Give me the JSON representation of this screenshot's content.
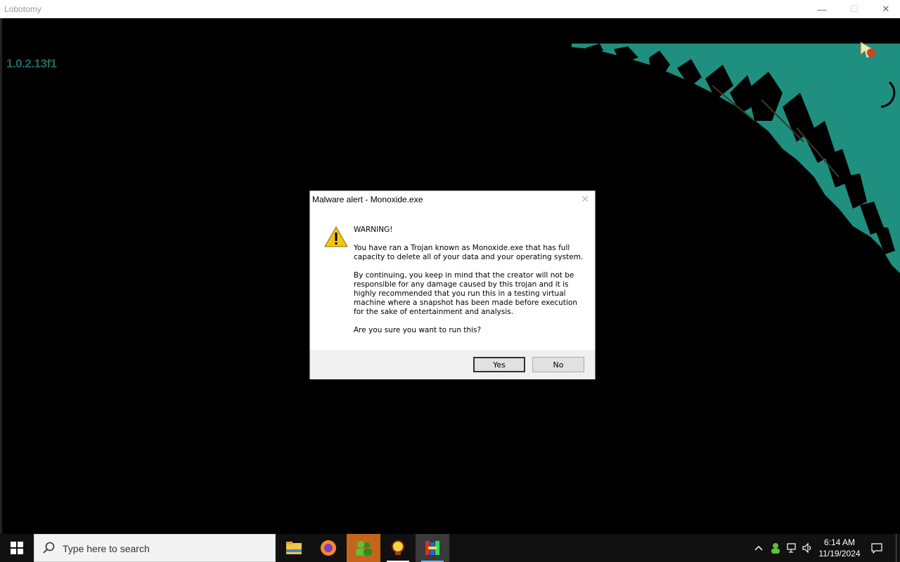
{
  "window": {
    "title": "Lobotomy",
    "controls": {
      "minimize": "—",
      "maximize": "☐",
      "close": "✕"
    }
  },
  "app": {
    "version": "1.0.2.13f1"
  },
  "dialog": {
    "title": "Malware alert - Monoxide.exe",
    "close": "✕",
    "heading": "WARNING!",
    "paragraph1": "You have ran a Trojan known as Monoxide.exe that has full capacity to delete all of your data and your operating system.",
    "paragraph2": "By continuing, you keep in mind that the creator will not be responsible for any damage caused by this trojan and it is highly recommended that you run this in a testing virtual machine where a snapshot has been made before execution for the sake of entertainment and analysis.",
    "question": "Are you sure you want to run this?",
    "yes_label": "Yes",
    "no_label": "No"
  },
  "taskbar": {
    "search_placeholder": "Type here to search",
    "apps": [
      "file-explorer",
      "firefox",
      "user-app",
      "app-4",
      "app-5"
    ],
    "time": "6:14 AM",
    "date": "11/19/2024"
  },
  "colors": {
    "accent": "#1e6a64",
    "teal": "#1f8f7f",
    "taskbar": "#111111"
  }
}
